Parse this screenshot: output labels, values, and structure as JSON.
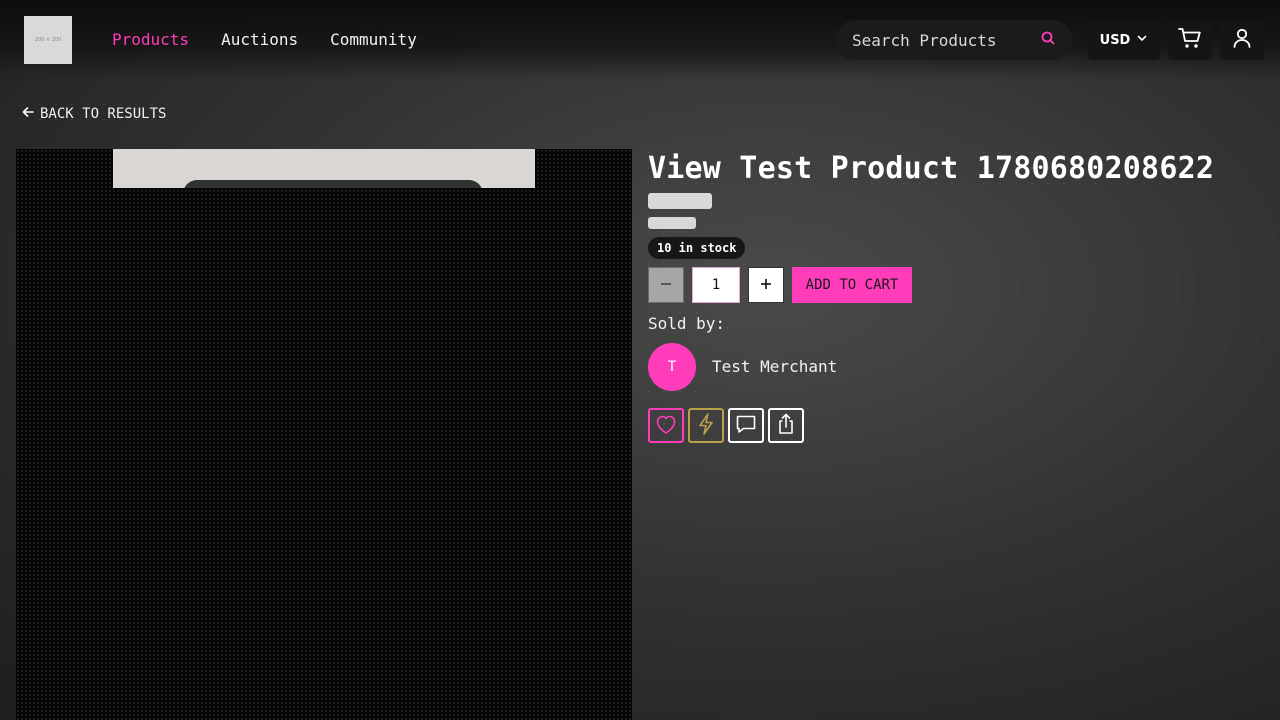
{
  "header": {
    "logo_text": "200 × 200",
    "nav": [
      {
        "label": "Products",
        "active": true
      },
      {
        "label": "Auctions",
        "active": false
      },
      {
        "label": "Community",
        "active": false
      }
    ],
    "search": {
      "placeholder": "Search Products",
      "icon": "search-icon"
    },
    "currency": "USD",
    "icons": [
      "cart-icon",
      "user-icon"
    ]
  },
  "back_link": {
    "label": "BACK TO RESULTS",
    "icon": "arrow-left-icon"
  },
  "product": {
    "title": "View Test Product 1780680208622",
    "stock": "10 in stock",
    "quantity": "1",
    "add_to_cart": "ADD TO CART",
    "sold_by_label": "Sold by:",
    "merchant": {
      "initial": "T",
      "name": "Test Merchant"
    },
    "actions": [
      "heart-icon",
      "lightning-icon",
      "message-icon",
      "share-icon"
    ]
  },
  "colors": {
    "accent": "#ff3dbb",
    "boost": "#b8a14a",
    "panel": "#151515"
  }
}
